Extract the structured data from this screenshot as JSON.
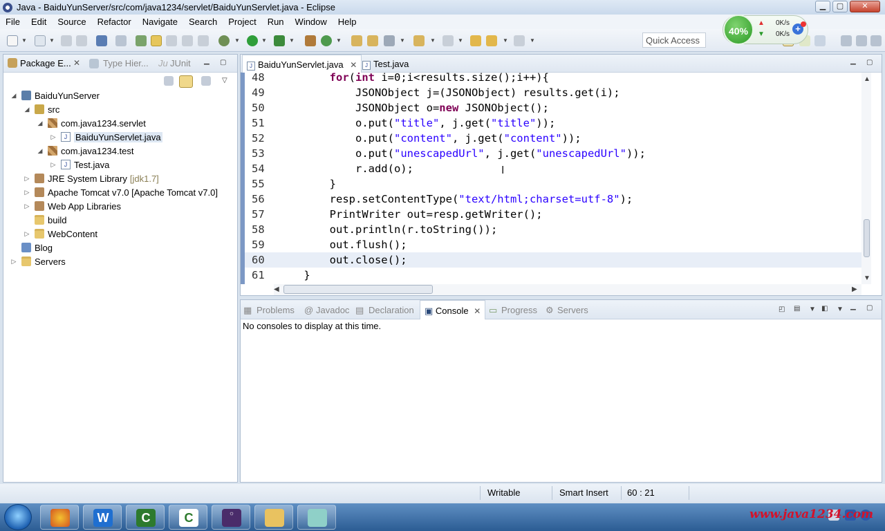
{
  "window": {
    "title": "Java - BaiduYunServer/src/com/java1234/servlet/BaiduYunServlet.java - Eclipse"
  },
  "menu": [
    "File",
    "Edit",
    "Source",
    "Refactor",
    "Navigate",
    "Search",
    "Project",
    "Run",
    "Window",
    "Help"
  ],
  "toolbar": {
    "quick_access": "Quick Access",
    "perspective": "Java"
  },
  "net_meter": {
    "percent": "40%",
    "up_speed": "0K/s",
    "down_speed": "0K/s",
    "plus": "+"
  },
  "package_explorer": {
    "tabs": [
      "Package E...",
      "Type Hier...",
      "JUnit"
    ],
    "tree": [
      {
        "label": "BaiduYunServer",
        "extra": ""
      },
      {
        "label": "src",
        "extra": ""
      },
      {
        "label": "com.java1234.servlet",
        "extra": ""
      },
      {
        "label": "BaiduYunServlet.java",
        "extra": ""
      },
      {
        "label": "com.java1234.test",
        "extra": ""
      },
      {
        "label": "Test.java",
        "extra": ""
      },
      {
        "label": "JRE System Library",
        "extra": "[jdk1.7]"
      },
      {
        "label": "Apache Tomcat v7.0 [Apache Tomcat v7.0]",
        "extra": ""
      },
      {
        "label": "Web App Libraries",
        "extra": ""
      },
      {
        "label": "build",
        "extra": ""
      },
      {
        "label": "WebContent",
        "extra": ""
      },
      {
        "label": "Blog",
        "extra": ""
      },
      {
        "label": "Servers",
        "extra": ""
      }
    ]
  },
  "editor": {
    "tabs": [
      "BaiduYunServlet.java",
      "Test.java"
    ],
    "lines": [
      {
        "num": "48",
        "text": "        for(int i=0;i<results.size();i++){"
      },
      {
        "num": "49",
        "text": "            JSONObject j=(JSONObject) results.get(i);"
      },
      {
        "num": "50",
        "text": "            JSONObject o=new JSONObject();"
      },
      {
        "num": "51",
        "text": "            o.put(\"title\", j.get(\"title\"));"
      },
      {
        "num": "52",
        "text": "            o.put(\"content\", j.get(\"content\"));"
      },
      {
        "num": "53",
        "text": "            o.put(\"unescapedUrl\", j.get(\"unescapedUrl\"));"
      },
      {
        "num": "54",
        "text": "            r.add(o);"
      },
      {
        "num": "55",
        "text": "        }"
      },
      {
        "num": "56",
        "text": "        resp.setContentType(\"text/html;charset=utf-8\");"
      },
      {
        "num": "57",
        "text": "        PrintWriter out=resp.getWriter();"
      },
      {
        "num": "58",
        "text": "        out.println(r.toString());"
      },
      {
        "num": "59",
        "text": "        out.flush();"
      },
      {
        "num": "60",
        "text": "        out.close();"
      },
      {
        "num": "61",
        "text": "    }"
      }
    ],
    "current_line": "60"
  },
  "console": {
    "tabs": [
      "Problems",
      "Javadoc",
      "Declaration",
      "Console",
      "Progress",
      "Servers"
    ],
    "message": "No consoles to display at this time."
  },
  "status": {
    "writable": "Writable",
    "insert_mode": "Smart Insert",
    "position": "60 : 21"
  },
  "watermark": "www.java1234.com",
  "colors": {
    "keyword": "#7f0055",
    "string": "#2a00ff",
    "current_line": "#e8eef7"
  }
}
